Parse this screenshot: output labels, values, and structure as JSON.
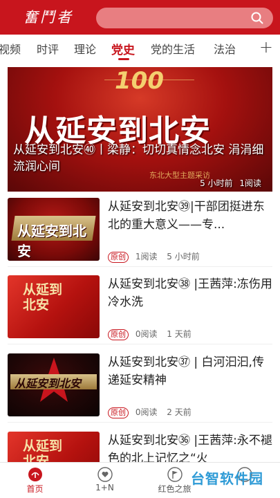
{
  "header": {
    "logo": "奮鬥者",
    "search_icon": "search-icon"
  },
  "tabs": [
    "视频",
    "时评",
    "理论",
    "党史",
    "党的生活",
    "法治"
  ],
  "active_tab": "党史",
  "hero": {
    "image_title": "从延安到北安",
    "image_badge": "100",
    "image_side_text": "东北大型主题采访",
    "caption": "从延安到北安㊵丨梁静：切切真情念北安 涓涓细流润心间",
    "time": "5 小时前",
    "reads": "1阅读"
  },
  "articles": [
    {
      "thumb": "从延安到北安",
      "title": "从延安到北安㊴|干部团挺进东北的重大意义——专...",
      "badge": "原创",
      "reads": "1阅读",
      "time": "5 小时前"
    },
    {
      "thumb": "从延到北安",
      "title": "从延安到北安㊳ |王茜萍:冻伤用冷水洗",
      "badge": "原创",
      "reads": "0阅读",
      "time": "1 天前"
    },
    {
      "thumb": "从延安到北安",
      "title": "从延安到北安㊲ | 白河汩汩,传递延安精神",
      "badge": "原创",
      "reads": "0阅读",
      "time": "2 天前"
    },
    {
      "thumb": "从延到北安",
      "title": "从延安到北安㊱ |王茜萍:永不褪色的北上记忆之“火",
      "badge": "",
      "reads": "",
      "time": ""
    }
  ],
  "bottom_nav": [
    {
      "label": "首页",
      "icon": "home-logo-icon"
    },
    {
      "label": "1+N",
      "icon": "heart-icon"
    },
    {
      "label": "红色之旅",
      "icon": "flag-icon"
    },
    {
      "label": "",
      "icon": "user-icon"
    }
  ],
  "watermark": "台智软件园",
  "colors": {
    "brand_red": "#c8151d"
  }
}
